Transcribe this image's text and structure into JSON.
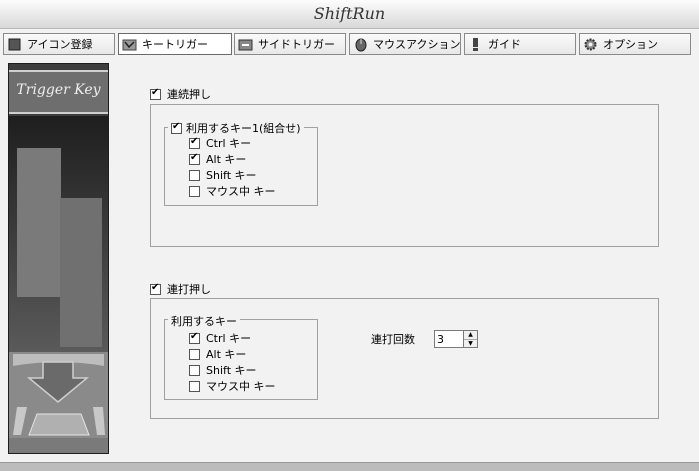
{
  "window": {
    "title": "ShiftRun"
  },
  "tabs": [
    {
      "label": "アイコン登録",
      "icon": "icon-register-icon"
    },
    {
      "label": "キートリガー",
      "icon": "key-trigger-icon",
      "active": true
    },
    {
      "label": "サイドトリガー",
      "icon": "side-trigger-icon"
    },
    {
      "label": "マウスアクション",
      "icon": "mouse-action-icon"
    },
    {
      "label": "ガイド",
      "icon": "guide-icon"
    },
    {
      "label": "オプション",
      "icon": "gear-icon"
    }
  ],
  "side_panel": {
    "title": "Trigger Key"
  },
  "continuous": {
    "label": "連続押し",
    "checked": true,
    "group": {
      "label": "利用するキー1(組合せ)",
      "checked": true,
      "keys": [
        {
          "label": "Ctrl キー",
          "checked": true
        },
        {
          "label": "Alt キー",
          "checked": true
        },
        {
          "label": "Shift キー",
          "checked": false
        },
        {
          "label": "マウス中 キー",
          "checked": false
        }
      ]
    }
  },
  "repeat": {
    "label": "連打押し",
    "checked": true,
    "group": {
      "label": "利用するキー",
      "keys": [
        {
          "label": "Ctrl キー",
          "checked": true
        },
        {
          "label": "Alt キー",
          "checked": false
        },
        {
          "label": "Shift キー",
          "checked": false
        },
        {
          "label": "マウス中 キー",
          "checked": false
        }
      ]
    },
    "count_label": "連打回数",
    "count_value": "3"
  }
}
